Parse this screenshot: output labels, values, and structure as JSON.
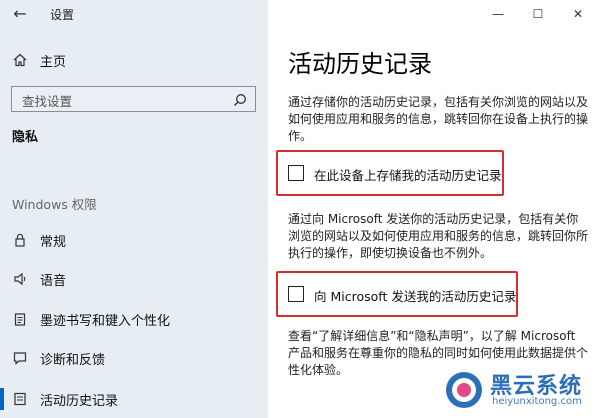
{
  "window": {
    "title": "设置"
  },
  "sidebar": {
    "home_label": "主页",
    "search_placeholder": "查找设置",
    "privacy_heading": "隐私",
    "windows_section": "Windows 权限",
    "items": [
      {
        "label": "常规",
        "icon": "lock-icon"
      },
      {
        "label": "语音",
        "icon": "speech-icon"
      },
      {
        "label": "墨迹书写和键入个性化",
        "icon": "clipboard-icon"
      },
      {
        "label": "诊断和反馈",
        "icon": "feedback-icon"
      },
      {
        "label": "活动历史记录",
        "icon": "history-icon",
        "active": true
      }
    ]
  },
  "main": {
    "title": "活动历史记录",
    "para1": "通过存储你的活动历史记录，包括有关你浏览的网站以及如何使用应用和服务的信息，跳转回你在设备上执行的操作。",
    "checkbox1_label": "在此设备上存储我的活动历史记录",
    "para2": "通过向 Microsoft 发送你的活动历史记录，包括有关你浏览的网站以及如何使用应用和服务的信息，跳转回你所执行的操作，即使切换设备也不例外。",
    "checkbox2_label": "向 Microsoft 发送我的活动历史记录",
    "para3": "查看“了解详细信息”和“隐私声明”，以了解 Microsoft 产品和服务在尊重你的隐私的同时如何使用此数据提供个性化体验。"
  },
  "watermark": {
    "name": "黑云系统",
    "url": "heiyunxitong.com"
  },
  "colors": {
    "accent": "#0067c0",
    "highlight": "#d32f2f",
    "sidebar_bg": "#e6edf3"
  }
}
